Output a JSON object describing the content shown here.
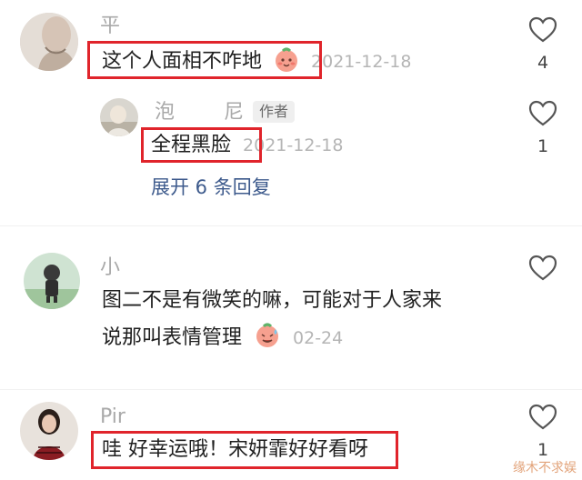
{
  "comments": [
    {
      "name": "平",
      "text": "这个人面相不咋地",
      "date": "2021-12-18",
      "likes": "4",
      "reply": {
        "name": "泡",
        "name_tail": "尼",
        "author_tag": "作者",
        "text": "全程黑脸",
        "date": "2021-12-18",
        "likes": "1"
      },
      "expand_label": "展开 6 条回复"
    },
    {
      "name": "小",
      "text_line1": "图二不是有微笑的嘛，可能对于人家来",
      "text_line2": "说那叫表情管理",
      "date": "02-24"
    },
    {
      "name": "Pir",
      "text": "哇 好幸运哦！宋妍霏好好看呀",
      "likes": "1"
    }
  ],
  "watermark": "缘木不求娱",
  "colors": {
    "highlight_box": "#e0242b",
    "link": "#3d5a8c"
  }
}
